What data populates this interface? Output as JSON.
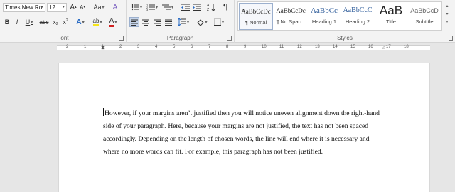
{
  "font": {
    "font_name": "Times New Ro",
    "font_size": "12",
    "grow_label": "A",
    "shrink_label": "A",
    "case_label": "Aa",
    "clear_label": "A",
    "bold": "B",
    "italic": "I",
    "underline": "U",
    "strike": "abc",
    "subscript": "x",
    "superscript": "x",
    "effects_label": "A",
    "highlight_label": "ab",
    "color_label": "A",
    "group_label": "Font"
  },
  "paragraph": {
    "group_label": "Paragraph",
    "show_marks": "¶"
  },
  "styles": {
    "group_label": "Styles",
    "items": [
      {
        "sample": "AaBbCcDc",
        "name": "¶ Normal"
      },
      {
        "sample": "AaBbCcDc",
        "name": "¶ No Spac..."
      },
      {
        "sample": "AaBbCc",
        "name": "Heading 1"
      },
      {
        "sample": "AaBbCcC",
        "name": "Heading 2"
      },
      {
        "sample": "AaB",
        "name": "Title"
      },
      {
        "sample": "AaBbCcD",
        "name": "Subtitle"
      }
    ]
  },
  "ruler": {
    "labels": [
      "2",
      "1",
      "1",
      "2",
      "3",
      "4",
      "5",
      "6",
      "7",
      "8",
      "9",
      "10",
      "11",
      "12",
      "13",
      "14",
      "15",
      "16",
      "17",
      "18"
    ]
  },
  "document": {
    "paragraph": "However, if your margins aren’t justified then you will notice uneven alignment down the right-hand side of your paragraph. Here, because your margins are not justified, the text has not been spaced accordingly. Depending on the length of chosen words, the line will end where it is necessary and where no more words can fit. For example, this paragraph has not been justified."
  },
  "colors": {
    "highlight": "#f5e41a",
    "font_color": "#d02020",
    "effects": "#2b6cc4"
  }
}
